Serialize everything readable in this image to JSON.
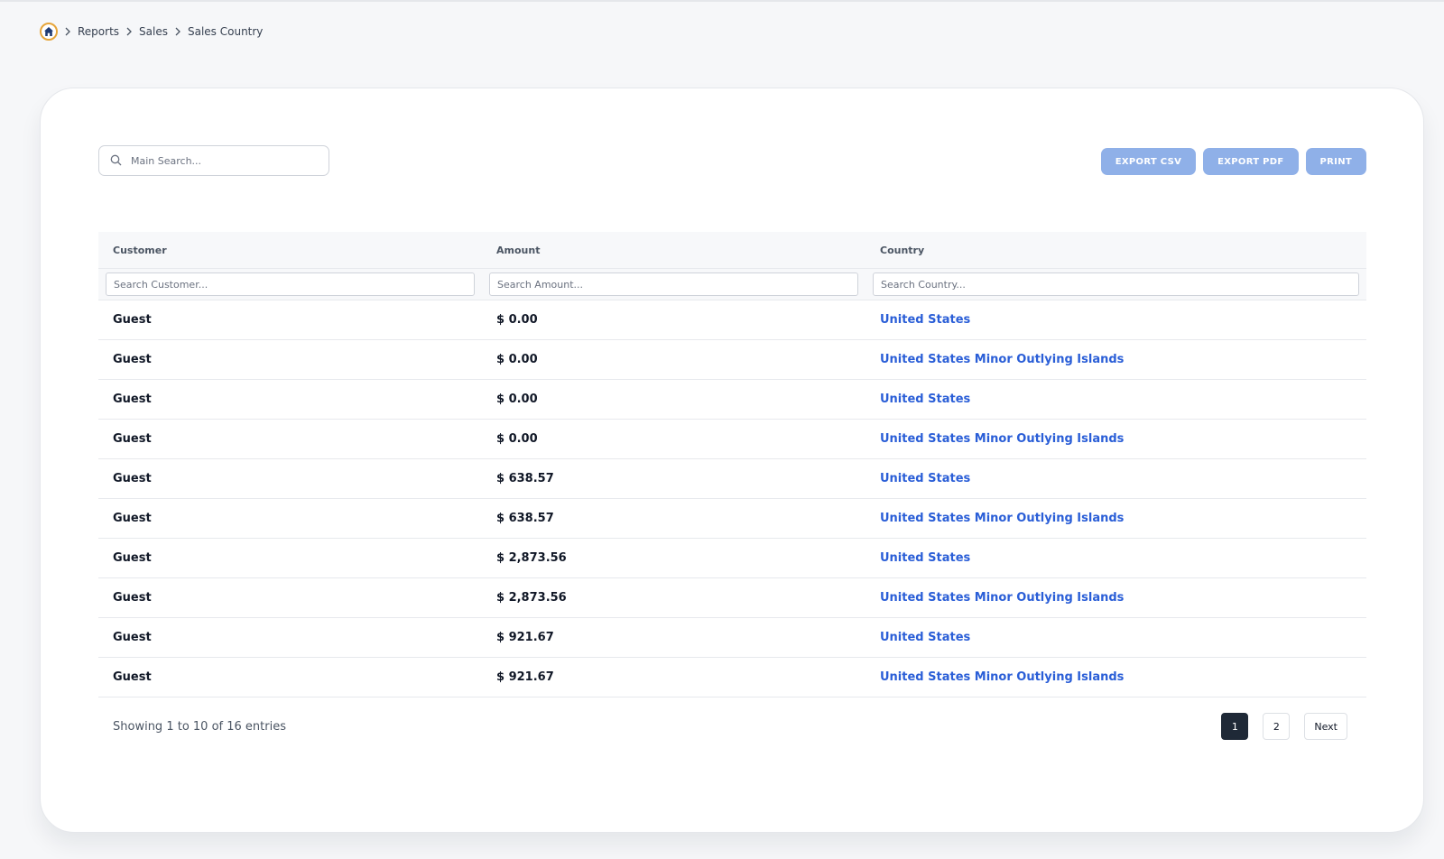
{
  "breadcrumb": {
    "items": [
      "Reports",
      "Sales",
      "Sales Country"
    ]
  },
  "search": {
    "placeholder": "Main Search..."
  },
  "actions": {
    "export_csv": "EXPORT CSV",
    "export_pdf": "EXPORT PDF",
    "print": "PRINT"
  },
  "table": {
    "headers": [
      "Customer",
      "Amount",
      "Country"
    ],
    "filters": [
      "Search Customer...",
      "Search Amount...",
      "Search Country..."
    ],
    "rows": [
      [
        "Guest",
        "$ 0.00",
        "United States"
      ],
      [
        "Guest",
        "$ 0.00",
        "United States Minor Outlying Islands"
      ],
      [
        "Guest",
        "$ 0.00",
        "United States"
      ],
      [
        "Guest",
        "$ 0.00",
        "United States Minor Outlying Islands"
      ],
      [
        "Guest",
        "$ 638.57",
        "United States"
      ],
      [
        "Guest",
        "$ 638.57",
        "United States Minor Outlying Islands"
      ],
      [
        "Guest",
        "$ 2,873.56",
        "United States"
      ],
      [
        "Guest",
        "$ 2,873.56",
        "United States Minor Outlying Islands"
      ],
      [
        "Guest",
        "$ 921.67",
        "United States"
      ],
      [
        "Guest",
        "$ 921.67",
        "United States Minor Outlying Islands"
      ]
    ]
  },
  "footer": {
    "info": "Showing 1 to 10 of 16 entries"
  },
  "pagination": {
    "pages": [
      "1",
      "2"
    ],
    "active": "1",
    "next": "Next"
  },
  "colors": {
    "accent": "#8fb0e8",
    "link": "#2a5ed7",
    "active_page": "#1f2937",
    "home_ring": "#e6a53a"
  }
}
